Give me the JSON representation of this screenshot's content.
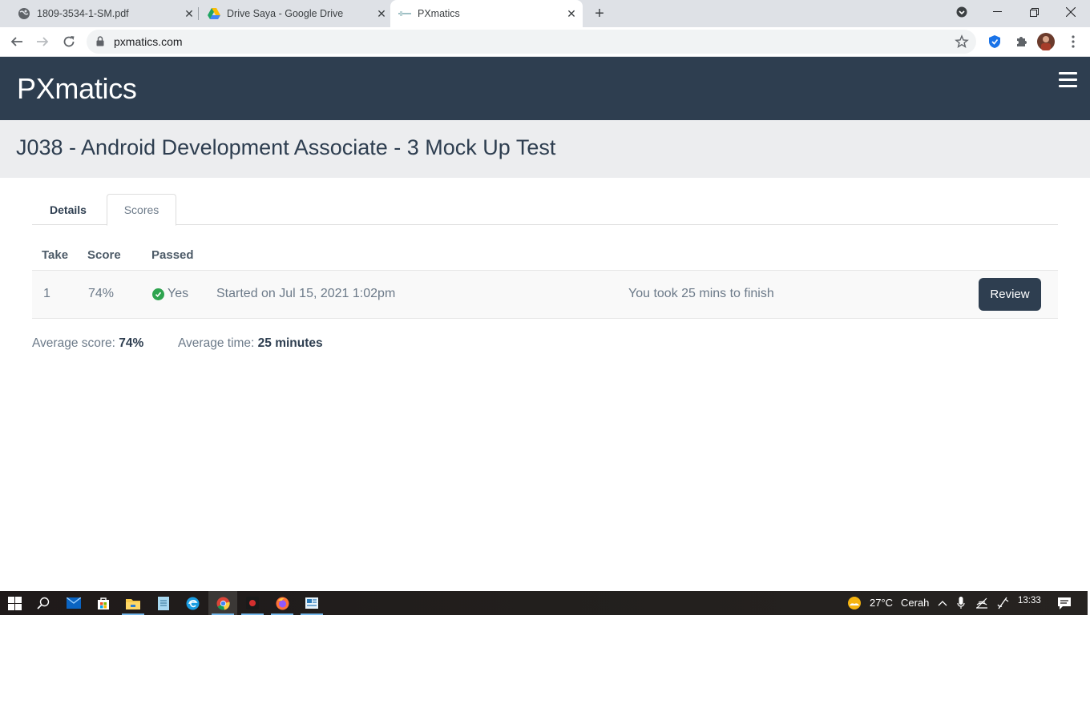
{
  "browser": {
    "tabs": [
      {
        "title": "1809-3534-1-SM.pdf",
        "icon": "globe-icon"
      },
      {
        "title": "Drive Saya - Google Drive",
        "icon": "google-drive-icon"
      },
      {
        "title": "PXmatics",
        "icon": "pxmatics-favicon",
        "active": true
      }
    ],
    "url": "pxmatics.com"
  },
  "site": {
    "brand": "PXmatics",
    "page_title": "J038 - Android Development Associate - 3 Mock Up Test"
  },
  "page_tabs": [
    {
      "label": "Details",
      "active": false
    },
    {
      "label": "Scores",
      "active": true
    }
  ],
  "scores_table": {
    "headers": {
      "take": "Take",
      "score": "Score",
      "passed": "Passed"
    },
    "rows": [
      {
        "take": "1",
        "score": "74%",
        "passed": "Yes",
        "started": "Started on Jul 15, 2021 1:02pm",
        "duration": "You took 25 mins to finish",
        "action": "Review"
      }
    ]
  },
  "summary": {
    "avg_score_label": "Average score:",
    "avg_score_value": "74%",
    "avg_time_label": "Average time:",
    "avg_time_value": "25 minutes"
  },
  "taskbar": {
    "weather_temp": "27°C",
    "weather_text": "Cerah",
    "clock": "13:33"
  },
  "colors": {
    "header_bg": "#2e3e50",
    "title_band_bg": "#ecedef",
    "accent_green": "#2ea44f"
  }
}
